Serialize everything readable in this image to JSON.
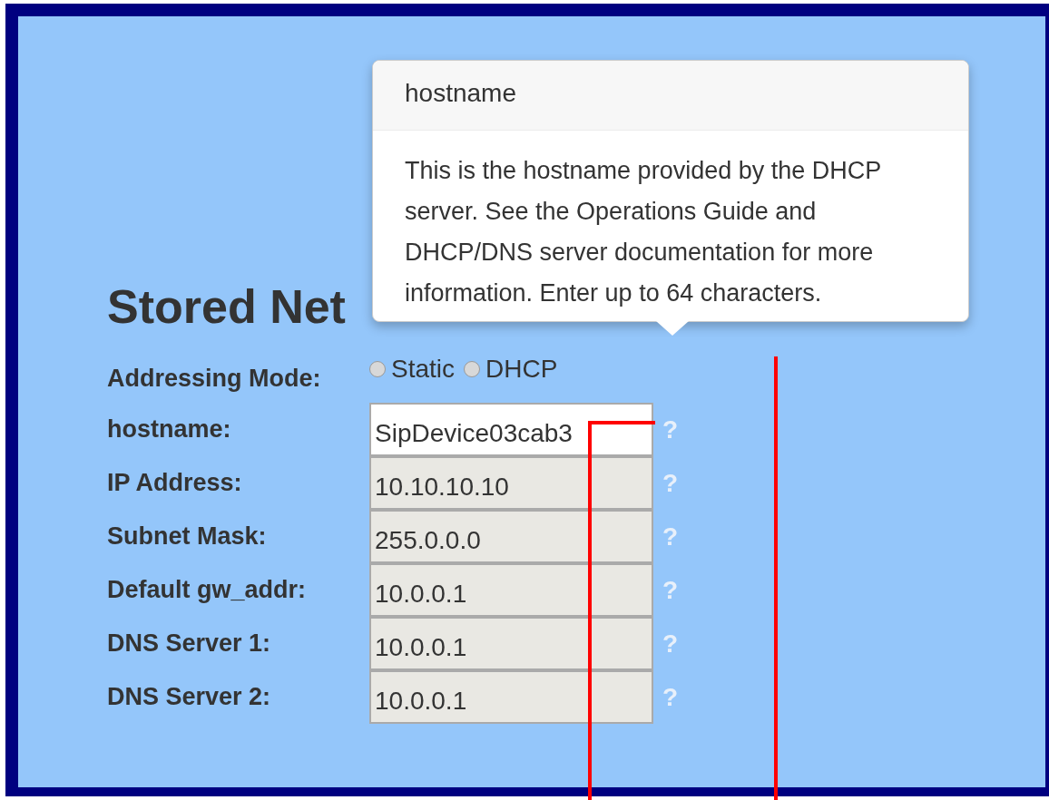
{
  "heading": "Stored Net",
  "addressing": {
    "label": "Addressing Mode:",
    "options": [
      {
        "label": "Static",
        "selected": false
      },
      {
        "label": "DHCP",
        "selected": false
      }
    ]
  },
  "fields": [
    {
      "label": "hostname:",
      "value": "SipDevice03cab3",
      "disabled": false,
      "help": "?"
    },
    {
      "label": "IP Address:",
      "value": "10.10.10.10",
      "disabled": true,
      "help": "?"
    },
    {
      "label": "Subnet Mask:",
      "value": "255.0.0.0",
      "disabled": true,
      "help": "?"
    },
    {
      "label": "Default gw_addr:",
      "value": "10.0.0.1",
      "disabled": true,
      "help": "?"
    },
    {
      "label": "DNS Server 1:",
      "value": "10.0.0.1",
      "disabled": true,
      "help": "?"
    },
    {
      "label": "DNS Server 2:",
      "value": "10.0.0.1",
      "disabled": true,
      "help": "?"
    }
  ],
  "popover": {
    "title": "hostname",
    "body": "This is the hostname provided by the DHCP server. See the Operations Guide and DHCP/DNS server documentation for more information. Enter up to 64 characters."
  }
}
